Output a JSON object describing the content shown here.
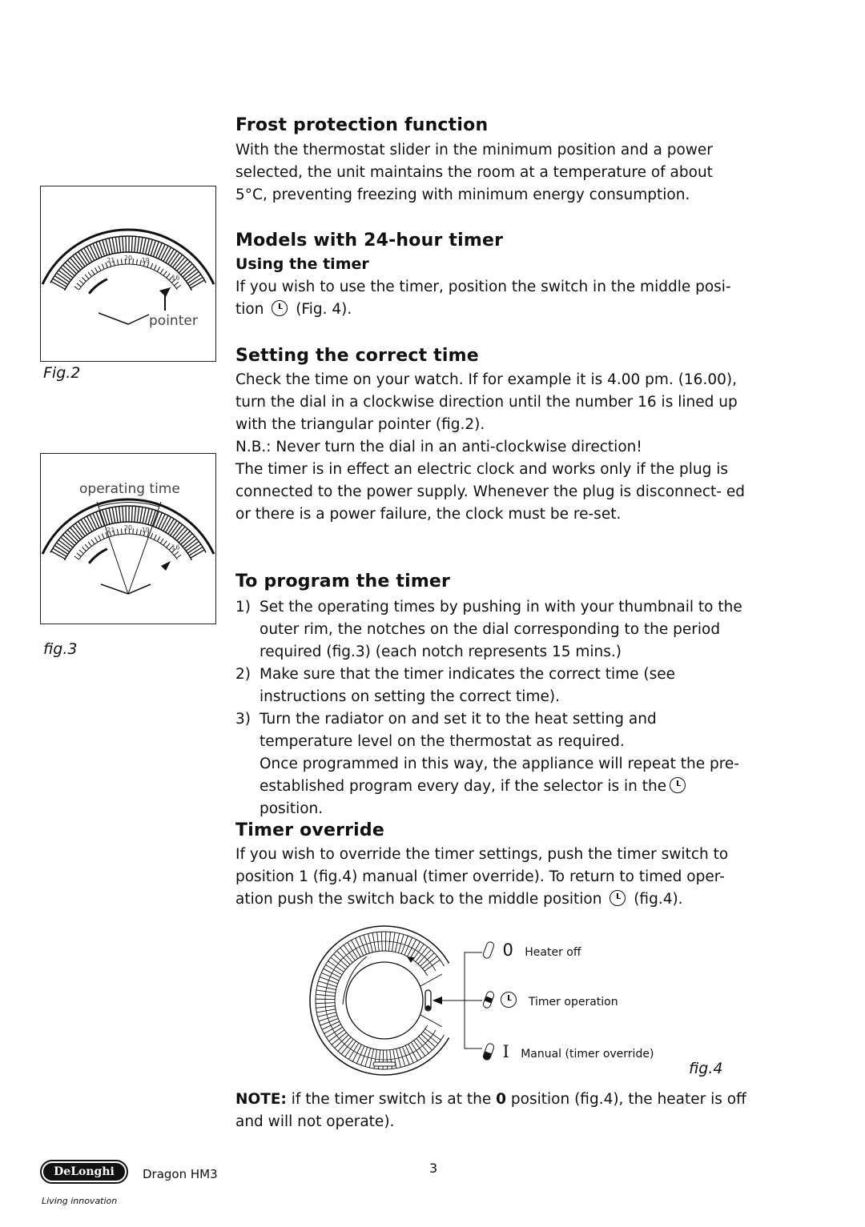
{
  "sections": {
    "frost": {
      "title": "Frost protection function",
      "text": "With the thermostat slider in the minimum position and a power selected, the unit maintains the room at a temperature of about 5°C, preventing freezing with minimum energy consumption."
    },
    "models": {
      "title": "Models with 24-hour timer",
      "subtitle": "Using the timer",
      "text_before": "If you wish to use the timer, position the switch in the middle posi- tion",
      "text_after": "(Fig. 4)."
    },
    "setting": {
      "title": "Setting the correct time",
      "text1": "Check the time on your watch. If for example it is 4.00 pm. (16.00), turn the dial in a clockwise direction until the number 16 is lined up with the triangular pointer (fig.2).",
      "text2": "N.B.: Never turn the dial in an anti-clockwise direction!",
      "text3": "The timer is in effect an electric clock and works only if the plug is connected to the power supply. Whenever the plug is disconnect- ed or there is a power failure, the clock must be re-set."
    },
    "program": {
      "title": "To program the timer",
      "steps": [
        {
          "n": "1)",
          "text": "Set the operating times by pushing in with your thumbnail to the outer rim, the notches on the dial corresponding to the period required (fig.3) (each notch represents 15 mins.)"
        },
        {
          "n": "2)",
          "text": "Make sure that the timer indicates the correct time (see instructions on setting the correct time)."
        },
        {
          "n": "3)",
          "text": "Turn the radiator on and set it to the heat setting and temperature level on the thermostat as required."
        }
      ],
      "note_before": "Once programmed in this way, the appliance will repeat the pre- established program every day, if the selector is in the",
      "note_after": "position."
    },
    "override": {
      "title": "Timer override",
      "text_before": "If you wish to override the timer settings, push the timer switch to position 1 (fig.4) manual (timer override). To return to timed oper- ation push the switch back to the middle position",
      "text_after": "(fig.4)."
    },
    "note": {
      "label": "NOTE:",
      "text_before": "if the timer switch is at the",
      "zero": "0",
      "text_after": "position (fig.4), the heater is off and will not operate)."
    }
  },
  "figures": {
    "fig2": {
      "caption": "Fig.2",
      "pointer_label": "pointer",
      "dial_numbers": [
        "21",
        "20",
        "19",
        "16"
      ]
    },
    "fig3": {
      "caption": "fig.3",
      "label": "operating time",
      "dial_numbers": [
        "21",
        "20",
        "19",
        "16"
      ]
    },
    "fig4": {
      "caption": "fig.4",
      "positions": [
        {
          "symbol": "0",
          "label": "Heater off"
        },
        {
          "symbol": "clock-icon",
          "label": "Timer operation"
        },
        {
          "symbol": "I",
          "label": "Manual (timer override)"
        }
      ]
    }
  },
  "footer": {
    "brand": "DeLonghi",
    "tagline": "Living innovation",
    "model": "Dragon HM3",
    "page_number": "3"
  }
}
